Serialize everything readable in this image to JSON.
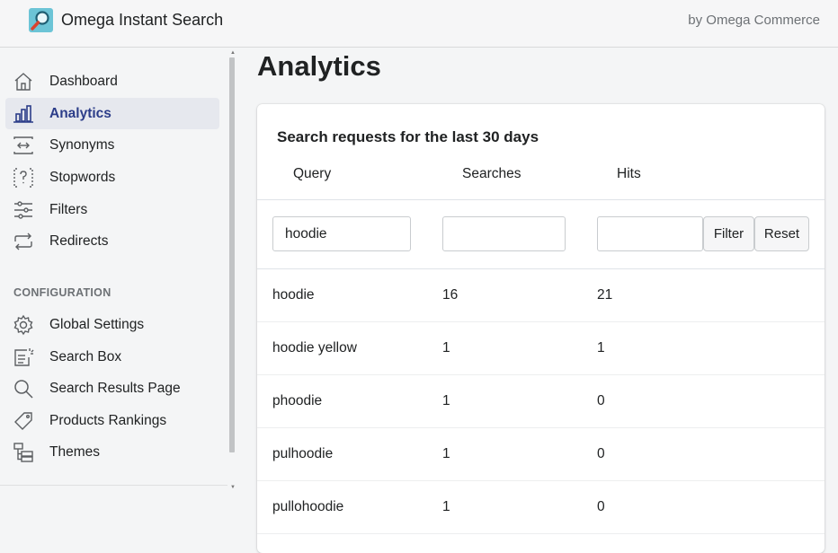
{
  "header": {
    "app_title": "Omega Instant Search",
    "byline": "by Omega Commerce"
  },
  "sidebar": {
    "items": [
      {
        "label": "Dashboard",
        "icon": "home-icon"
      },
      {
        "label": "Analytics",
        "icon": "bar-chart-icon",
        "active": true
      },
      {
        "label": "Synonyms",
        "icon": "swap-arrows-icon"
      },
      {
        "label": "Stopwords",
        "icon": "question-brackets-icon"
      },
      {
        "label": "Filters",
        "icon": "sliders-icon"
      },
      {
        "label": "Redirects",
        "icon": "repeat-arrows-icon"
      }
    ],
    "config_heading": "CONFIGURATION",
    "config_items": [
      {
        "label": "Global Settings",
        "icon": "gear-icon"
      },
      {
        "label": "Search Box",
        "icon": "search-box-icon"
      },
      {
        "label": "Search Results Page",
        "icon": "search-icon"
      },
      {
        "label": "Products Rankings",
        "icon": "tag-icon"
      },
      {
        "label": "Themes",
        "icon": "themes-icon"
      }
    ]
  },
  "main": {
    "page_title": "Analytics",
    "card_title": "Search requests for the last 30 days",
    "columns": [
      "Query",
      "Searches",
      "Hits"
    ],
    "filters": {
      "query_value": "hoodie",
      "searches_value": "",
      "hits_value": "",
      "filter_label": "Filter",
      "reset_label": "Reset"
    },
    "rows": [
      {
        "query": "hoodie",
        "searches": "16",
        "hits": "21"
      },
      {
        "query": "hoodie yellow",
        "searches": "1",
        "hits": "1"
      },
      {
        "query": "phoodie",
        "searches": "1",
        "hits": "0"
      },
      {
        "query": "pulhoodie",
        "searches": "1",
        "hits": "0"
      },
      {
        "query": "pullohoodie",
        "searches": "1",
        "hits": "0"
      }
    ]
  },
  "colors": {
    "accent": "#2c3d89",
    "active_bg": "#e6e8ee"
  }
}
